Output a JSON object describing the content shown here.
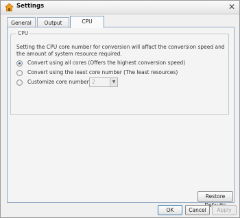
{
  "window": {
    "title": "Settings"
  },
  "tabs": [
    {
      "label": "General",
      "active": false
    },
    {
      "label": "Output",
      "active": false
    },
    {
      "label": "CPU",
      "active": true
    }
  ],
  "cpu": {
    "group_title": "CPU",
    "description": "Setting the CPU core number for conversion will affact the conversion  speed and the amount of system resource required.",
    "options": [
      {
        "label": "Convert using all cores (Offers the highest conversion speed)",
        "checked": true
      },
      {
        "label": "Convert using the least core number (The least resources)",
        "checked": false
      },
      {
        "label": "Customize core number",
        "checked": false
      }
    ],
    "core_number": {
      "value": "2",
      "enabled": false
    }
  },
  "buttons": {
    "restore_defaults": "Restore Defaults",
    "ok": "OK",
    "cancel": "Cancel",
    "apply": "Apply"
  },
  "icons": {
    "app": "settings-house-icon",
    "close": "close-icon",
    "dropdown": "chevron-down-icon",
    "resize": "resize-grip-icon"
  },
  "colors": {
    "accent": "#2a4d8a",
    "tab_border": "#7f9db9"
  }
}
